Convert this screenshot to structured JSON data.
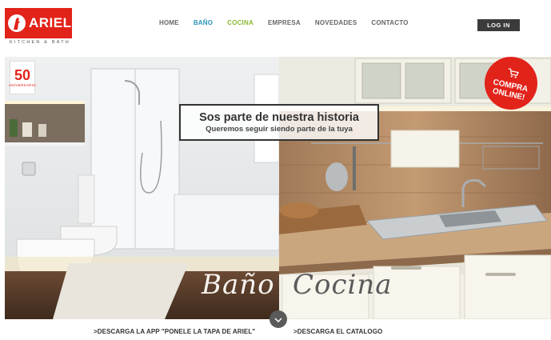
{
  "brand": {
    "name": "ARIEL",
    "subtitle": "KITCHEN & BATH",
    "color": "#e2231a"
  },
  "nav": {
    "items": [
      "HOME",
      "BAÑO",
      "COCINA",
      "EMPRESA",
      "NOVEDADES",
      "CONTACTO"
    ],
    "active_colors": {
      "BAÑO": "#2a93b8",
      "COCINA": "#8ab832"
    },
    "login": "LOG IN"
  },
  "hero": {
    "anniversary_number": "50",
    "anniversary_label": "ANIVERSARIO",
    "tagline_title": "Sos parte de nuestra historia",
    "tagline_sub": "Queremos seguir siendo parte de la tuya",
    "badge_line1": "COMPRA",
    "badge_line2": "ONLINE!",
    "left_label": "Baño",
    "right_label": "Cocina"
  },
  "footer": {
    "link_app": ">DESCARGA LA APP \"PONELE LA TAPA DE ARIEL\"",
    "link_catalog": ">DESCARGA EL CATALOGO"
  },
  "icons": [
    "ariel-logo-icon",
    "cart-icon",
    "chevron-down-icon"
  ]
}
